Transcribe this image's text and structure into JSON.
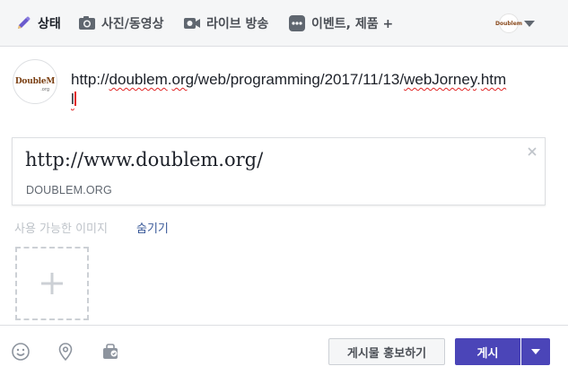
{
  "tabs": [
    {
      "label": "상태",
      "icon": "pencil-icon"
    },
    {
      "label": "사진/동영상",
      "icon": "camera-icon"
    },
    {
      "label": "라이브 방송",
      "icon": "video-camera-icon"
    },
    {
      "label": "이벤트, 제품 +",
      "icon": "more-dots-icon"
    }
  ],
  "page_switcher": {
    "logo_text": "Doublem",
    "icon": "chevron-down-icon"
  },
  "composer": {
    "avatar_text": "DoubleM",
    "avatar_sub": ".org",
    "text_line1_a": "http://",
    "text_line1_b": "doublem",
    "text_line1_c": ".",
    "text_line1_d": "org",
    "text_line1_e": "/web/programming/2017/11/13/",
    "text_line1_f": "webJorney",
    "text_line1_g": ".",
    "text_line1_h": "htm",
    "text_line2": "l"
  },
  "link_preview": {
    "title": "http://www.doublem.org/",
    "domain": "DOUBLEM.ORG"
  },
  "images": {
    "label": "사용 가능한 이미지",
    "hide_label": "숨기기"
  },
  "footer": {
    "promote_label": "게시물 홍보하기",
    "post_label": "게시"
  },
  "colors": {
    "accent": "#4267b2",
    "post_button": "#4b45b8",
    "link": "#385898",
    "spell_underline": "#e02424"
  }
}
